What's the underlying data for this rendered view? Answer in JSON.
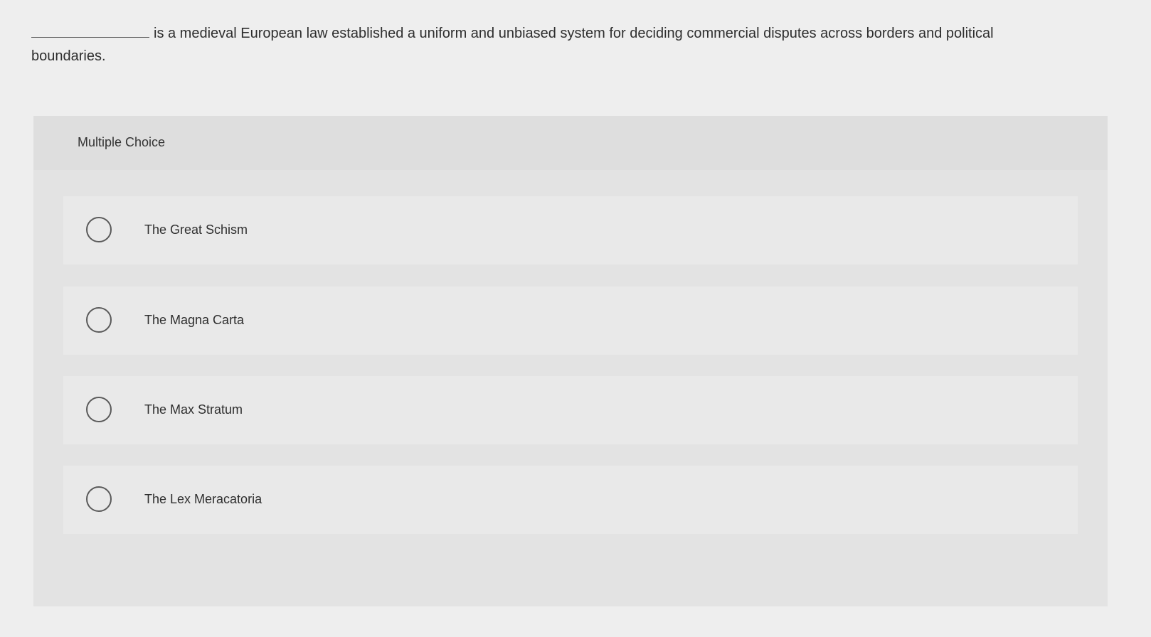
{
  "question": {
    "text": "is a medieval European law established a uniform and unbiased system for deciding commercial disputes across borders and political boundaries."
  },
  "panel": {
    "title": "Multiple Choice"
  },
  "options": [
    {
      "label": "The Great Schism"
    },
    {
      "label": "The Magna Carta"
    },
    {
      "label": "The Max Stratum"
    },
    {
      "label": "The Lex Meracatoria"
    }
  ]
}
